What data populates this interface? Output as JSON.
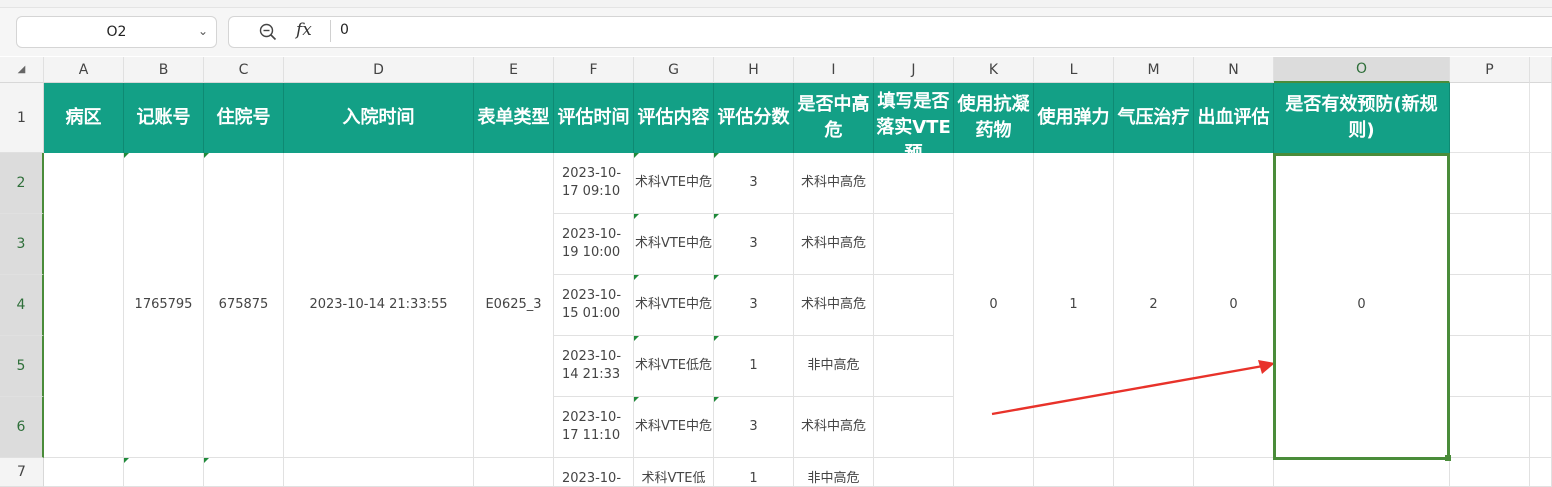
{
  "formula_bar": {
    "cell_ref": "O2",
    "fx_label": "fx",
    "value": "0"
  },
  "corner_glyph": "◢",
  "columns": [
    "A",
    "B",
    "C",
    "D",
    "E",
    "F",
    "G",
    "H",
    "I",
    "J",
    "K",
    "L",
    "M",
    "N",
    "O",
    "P"
  ],
  "selected_column": "O",
  "rows": [
    "1",
    "2",
    "3",
    "4",
    "5",
    "6",
    "7"
  ],
  "selected_rows": [
    "2",
    "3",
    "4",
    "5",
    "6"
  ],
  "headers": {
    "A": "病区",
    "B": "记账号",
    "C": "住院号",
    "D": "入院时间",
    "E": "表单类型",
    "F": "评估时间",
    "G": "评估内容",
    "H": "评估分数",
    "I": "是否中高危",
    "J": "填写是否落实VTE预",
    "K": "使用抗凝药物",
    "L": "使用弹力",
    "M": "气压治疗",
    "N": "出血评估",
    "O": "是否有效预防(新规则)"
  },
  "merged": {
    "B": "1765795",
    "C": "675875",
    "D": "2023-10-14 21:33:55",
    "E": "E0625_3",
    "K": "0",
    "L": "1",
    "M": "2",
    "N": "0",
    "O": "0"
  },
  "records": [
    {
      "F": "2023-10-17 09:10",
      "G": "术科VTE中危",
      "H": "3",
      "I": "术科中高危"
    },
    {
      "F": "2023-10-19 10:00",
      "G": "术科VTE中危",
      "H": "3",
      "I": "术科中高危"
    },
    {
      "F": "2023-10-15 01:00",
      "G": "术科VTE中危",
      "H": "3",
      "I": "术科中高危"
    },
    {
      "F": "2023-10-14 21:33",
      "G": "术科VTE低危",
      "H": "1",
      "I": "非中高危"
    },
    {
      "F": "2023-10-17 11:10",
      "G": "术科VTE中危",
      "H": "3",
      "I": "术科中高危"
    }
  ],
  "row7_partial": {
    "F": "2023-10-",
    "G": "术科VTE低",
    "H": "1",
    "I": "非中高危"
  },
  "colors": {
    "header_fill": "#13a086",
    "selection": "#4a8c3a",
    "annotation_arrow": "#e8322a"
  }
}
